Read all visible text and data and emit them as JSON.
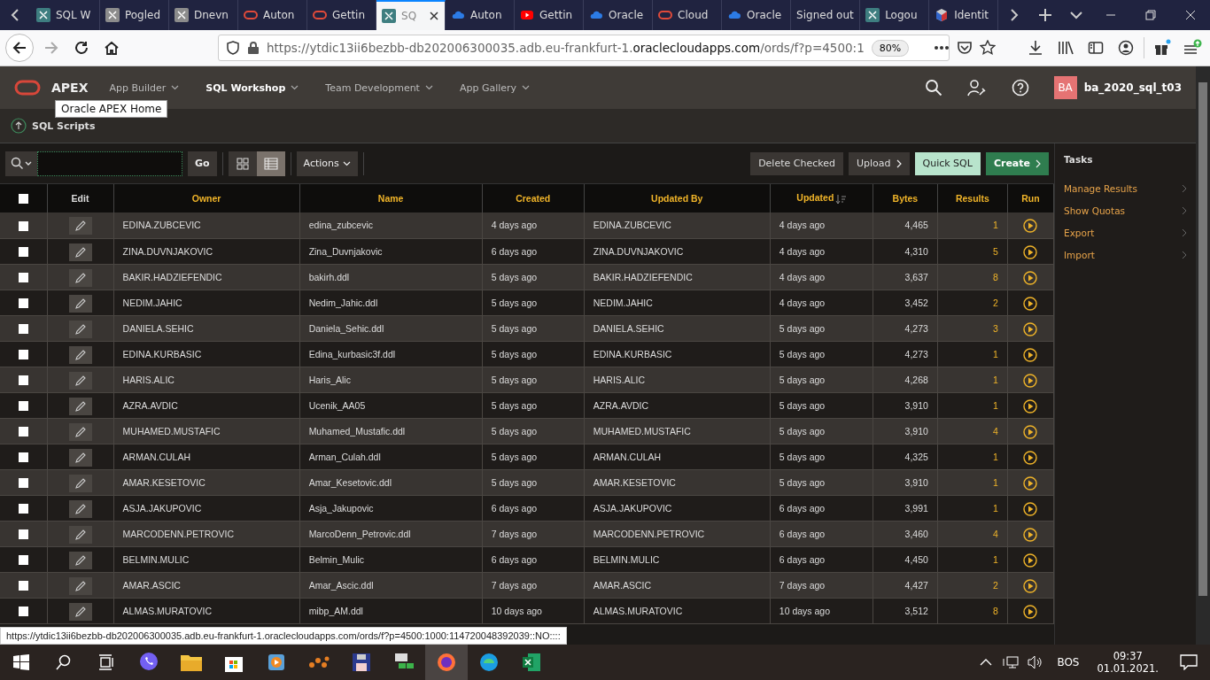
{
  "browser": {
    "tabs": [
      {
        "title": "SQL W",
        "kind": "apex",
        "selected": false
      },
      {
        "title": "Pogled",
        "kind": "faded",
        "selected": false
      },
      {
        "title": "Dnevn",
        "kind": "faded",
        "selected": false
      },
      {
        "title": "Auton",
        "kind": "ring",
        "selected": false
      },
      {
        "title": "Gettin",
        "kind": "ring",
        "selected": false
      },
      {
        "title": "SQ",
        "kind": "apex",
        "selected": true
      },
      {
        "title": "Auton",
        "kind": "cloud",
        "selected": false
      },
      {
        "title": "Gettin",
        "kind": "video",
        "selected": false
      },
      {
        "title": "Oracle",
        "kind": "cloud",
        "selected": false
      },
      {
        "title": "Cloud",
        "kind": "ring",
        "selected": false
      },
      {
        "title": "Oracle",
        "kind": "cloud",
        "selected": false
      },
      {
        "title": "Signed out",
        "kind": "plain",
        "selected": false
      },
      {
        "title": "Logou",
        "kind": "apex",
        "selected": false
      },
      {
        "title": "Identit",
        "kind": "cube",
        "selected": false
      }
    ],
    "url_host": "https://ytdic13ii6bezbb-db202006300035.adb.eu-frankfurt-1.",
    "url_domain": "oraclecloudapps.com",
    "url_path": "/ords/f?p=4500:1",
    "zoom": "80%",
    "status_url": "https://ytdic13ii6bezbb-db202006300035.adb.eu-frankfurt-1.oraclecloudapps.com/ords/f?p=4500:1000:114720048392039::NO::::"
  },
  "apex": {
    "logo": "APEX",
    "tooltip": "Oracle APEX Home",
    "nav": [
      {
        "label": "App Builder",
        "selected": false
      },
      {
        "label": "SQL Workshop",
        "selected": true
      },
      {
        "label": "Team Development",
        "selected": false
      },
      {
        "label": "App Gallery",
        "selected": false
      }
    ],
    "avatar": "BA",
    "user": "ba_2020_sql_t03"
  },
  "breadcrumb": "SQL Scripts",
  "toolbar": {
    "go": "Go",
    "views": [
      {
        "kind": "icons",
        "selected": false
      },
      {
        "kind": "report",
        "selected": true
      }
    ],
    "actions": "Actions",
    "buttons": [
      {
        "label": "Delete Checked",
        "kind": "plain"
      },
      {
        "label": "Upload",
        "kind": "plain-arrow"
      },
      {
        "label": "Quick SQL",
        "kind": "light"
      },
      {
        "label": "Create",
        "kind": "hot-arrow"
      }
    ]
  },
  "table": {
    "select_all": {
      "checked": false
    },
    "columns": [
      {
        "label": "Edit",
        "sorted": false
      },
      {
        "label": "Owner",
        "sorted": false
      },
      {
        "label": "Name",
        "sorted": false
      },
      {
        "label": "Created",
        "sorted": false
      },
      {
        "label": "Updated By",
        "sorted": false
      },
      {
        "label": "Updated",
        "sorted": true
      },
      {
        "label": "Bytes",
        "sorted": false
      },
      {
        "label": "Results",
        "sorted": false
      },
      {
        "label": "Run",
        "sorted": false
      }
    ],
    "rows": [
      {
        "checked": false,
        "owner": "EDINA.ZUBCEVIC",
        "name": "edina_zubcevic",
        "created": "4 days ago",
        "updated_by": "EDINA.ZUBCEVIC",
        "updated": "4 days ago",
        "bytes": "4,465",
        "results": "1"
      },
      {
        "checked": false,
        "owner": "ZINA.DUVNJAKOVIC",
        "name": "Zina_Duvnjakovic",
        "created": "6 days ago",
        "updated_by": "ZINA.DUVNJAKOVIC",
        "updated": "4 days ago",
        "bytes": "4,310",
        "results": "5"
      },
      {
        "checked": false,
        "owner": "BAKIR.HADZIEFENDIC",
        "name": "bakirh.ddl",
        "created": "5 days ago",
        "updated_by": "BAKIR.HADZIEFENDIC",
        "updated": "4 days ago",
        "bytes": "3,637",
        "results": "8"
      },
      {
        "checked": false,
        "owner": "NEDIM.JAHIC",
        "name": "Nedim_Jahic.ddl",
        "created": "5 days ago",
        "updated_by": "NEDIM.JAHIC",
        "updated": "4 days ago",
        "bytes": "3,452",
        "results": "2"
      },
      {
        "checked": false,
        "owner": "DANIELA.SEHIC",
        "name": "Daniela_Sehic.ddl",
        "created": "5 days ago",
        "updated_by": "DANIELA.SEHIC",
        "updated": "5 days ago",
        "bytes": "4,273",
        "results": "3"
      },
      {
        "checked": false,
        "owner": "EDINA.KURBASIC",
        "name": "Edina_kurbasic3f.ddl",
        "created": "5 days ago",
        "updated_by": "EDINA.KURBASIC",
        "updated": "5 days ago",
        "bytes": "4,273",
        "results": "1"
      },
      {
        "checked": false,
        "owner": "HARIS.ALIC",
        "name": "Haris_Alic",
        "created": "5 days ago",
        "updated_by": "HARIS.ALIC",
        "updated": "5 days ago",
        "bytes": "4,268",
        "results": "1"
      },
      {
        "checked": false,
        "owner": "AZRA.AVDIC",
        "name": "Ucenik_AA05",
        "created": "5 days ago",
        "updated_by": "AZRA.AVDIC",
        "updated": "5 days ago",
        "bytes": "3,910",
        "results": "1"
      },
      {
        "checked": false,
        "owner": "MUHAMED.MUSTAFIC",
        "name": "Muhamed_Mustafic.ddl",
        "created": "5 days ago",
        "updated_by": "MUHAMED.MUSTAFIC",
        "updated": "5 days ago",
        "bytes": "3,910",
        "results": "4"
      },
      {
        "checked": false,
        "owner": "ARMAN.CULAH",
        "name": "Arman_Culah.ddl",
        "created": "5 days ago",
        "updated_by": "ARMAN.CULAH",
        "updated": "5 days ago",
        "bytes": "4,325",
        "results": "1"
      },
      {
        "checked": false,
        "owner": "AMAR.KESETOVIC",
        "name": "Amar_Kesetovic.ddl",
        "created": "5 days ago",
        "updated_by": "AMAR.KESETOVIC",
        "updated": "5 days ago",
        "bytes": "3,910",
        "results": "1"
      },
      {
        "checked": false,
        "owner": "ASJA.JAKUPOVIC",
        "name": "Asja_Jakupovic",
        "created": "6 days ago",
        "updated_by": "ASJA.JAKUPOVIC",
        "updated": "6 days ago",
        "bytes": "3,991",
        "results": "1"
      },
      {
        "checked": false,
        "owner": "MARCODENN.PETROVIC",
        "name": "MarcoDenn_Petrovic.ddl",
        "created": "7 days ago",
        "updated_by": "MARCODENN.PETROVIC",
        "updated": "6 days ago",
        "bytes": "3,460",
        "results": "4"
      },
      {
        "checked": false,
        "owner": "BELMIN.MULIC",
        "name": "Belmin_Mulic",
        "created": "6 days ago",
        "updated_by": "BELMIN.MULIC",
        "updated": "6 days ago",
        "bytes": "4,450",
        "results": "1"
      },
      {
        "checked": false,
        "owner": "AMAR.ASCIC",
        "name": "Amar_Ascic.ddl",
        "created": "7 days ago",
        "updated_by": "AMAR.ASCIC",
        "updated": "7 days ago",
        "bytes": "4,427",
        "results": "2"
      },
      {
        "checked": false,
        "owner": "ALMAS.MURATOVIC",
        "name": "mibp_AM.ddl",
        "created": "10 days ago",
        "updated_by": "ALMAS.MURATOVIC",
        "updated": "10 days ago",
        "bytes": "3,512",
        "results": "8"
      }
    ]
  },
  "tasks": {
    "title": "Tasks",
    "items": [
      "Manage Results",
      "Show Quotas",
      "Export",
      "Import"
    ]
  },
  "taskbar": {
    "language": "BOS",
    "time": "09:37",
    "date": "01.01.2021."
  }
}
